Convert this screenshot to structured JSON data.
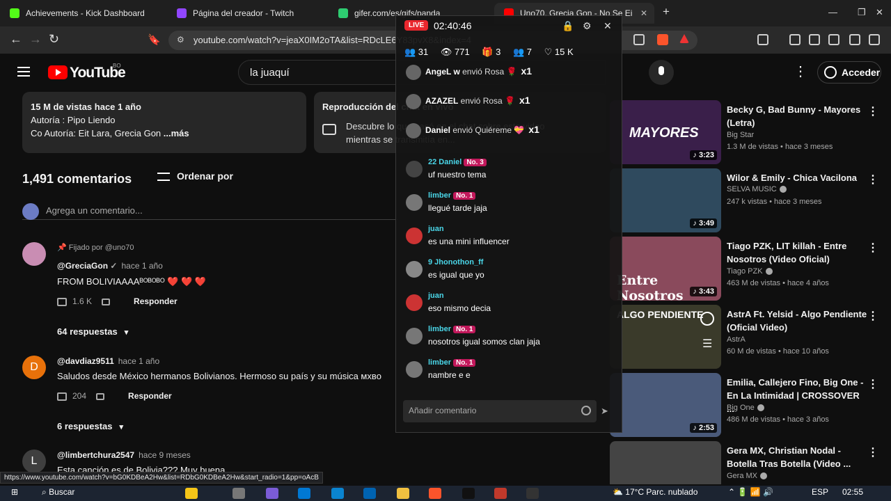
{
  "browser": {
    "tabs": [
      {
        "title": "Achievements - Kick Dashboard",
        "color": "#53fc18"
      },
      {
        "title": "Página del creador - Twitch",
        "color": "#9146ff"
      },
      {
        "title": "gifer.com/es/gifs/panda",
        "color": "#2ecc71"
      },
      {
        "title": "Uno70, Grecia Gon - No Se Ei",
        "color": "#ff0000"
      }
    ],
    "url": "youtube.com/watch?v=jeaX0IM2oTA&list=RDcLE6Y83pvX8&index=4",
    "new_tab": "+",
    "win_controls": [
      "—",
      "❐",
      "✕"
    ]
  },
  "youtube": {
    "logo": "YouTube",
    "country": "BO",
    "search_value": "la  juaquí",
    "signin_label": "Acceder"
  },
  "description": {
    "line1": "15 M de vistas  hace 1 año",
    "line2": "Autoría : Pipo Liendo",
    "line3": "Co Autoría: Eit Lara, Grecia Gon",
    "more": " ...más",
    "box2_title": "Reproducción del chat en vivo",
    "box2_text": "Descubre lo que pasó en el chat sobre este video mientras se transmitía en..."
  },
  "comments": {
    "count": "1,491 comentarios",
    "sort_label": "Ordenar por",
    "add_placeholder": "Agrega un comentario...",
    "items": [
      {
        "pinned": "Fijado por @uno70",
        "author": "@GreciaGon",
        "time": "hace 1 año",
        "text": "FROM BOLIVIAAAAᴮᴼᴮᴼᴮᴼ ❤️ ❤️ ❤️",
        "likes": "1.6 K",
        "reply": "Responder",
        "replies": "64 respuestas",
        "avatar": "",
        "avatar_color": "#c98db3"
      },
      {
        "pinned": "",
        "author": "@davdiaz9511",
        "time": "hace 1 año",
        "text": "Saludos desde México hermanos Bolivianos. Hermoso su país y su música ᴍxʙᴏ",
        "likes": "204",
        "reply": "Responder",
        "replies": "6 respuestas",
        "avatar": "D",
        "avatar_color": "#e8710a"
      },
      {
        "pinned": "",
        "author": "@limbertchura2547",
        "time": "hace 9 meses",
        "text": "Esta canción es de Bolivia??? Muy buena",
        "likes": "",
        "reply": "",
        "replies": "",
        "avatar": "L",
        "avatar_color": "#3f3f3f"
      }
    ]
  },
  "recommended": [
    {
      "title": "Becky G, Bad Bunny - Mayores (Letra)",
      "channel": "Big Star",
      "meta": "1.3 M de vistas • hace 3 meses",
      "duration": "3:23",
      "thumb_text": "MAYORES",
      "thumb_color": "#3a1f4a",
      "verified": false
    },
    {
      "title": "Wilor & Emily - Chica Vacilona",
      "channel": "SELVA MUSIC",
      "meta": "247 k vistas • hace 3 meses",
      "duration": "3:49",
      "thumb_text": "",
      "thumb_color": "#2f4a5e",
      "verified": true
    },
    {
      "title": "Tiago PZK, LIT killah - Entre Nosotros (Video Oficial)",
      "channel": "Tiago PZK",
      "meta": "463 M de vistas • hace 4 años",
      "duration": "3:43",
      "thumb_text": "Entre Nosotros",
      "thumb_color": "#8a4a5c",
      "verified": true
    },
    {
      "title": "AstrA Ft. Yelsid - Algo Pendiente (Oficial Video)",
      "channel": "AstrA",
      "meta": "60 M de vistas • hace 10 años",
      "duration": "",
      "thumb_text": "ALGO PENDIENTE",
      "thumb_color": "#3a3a2a",
      "verified": false
    },
    {
      "title": "Emilia, Callejero Fino, Big One - En La Intimidad | CROSSOVER ...",
      "channel": "Big One",
      "meta": "486 M de vistas • hace 3 años",
      "duration": "2:53",
      "thumb_text": "",
      "thumb_color": "#4a5a7a",
      "verified": true
    },
    {
      "title": "Gera MX, Christian Nodal - Botella Tras Botella (Video ...",
      "channel": "Gera MX",
      "meta": "",
      "duration": "",
      "thumb_text": "",
      "thumb_color": "#444444",
      "verified": true
    }
  ],
  "overlay": {
    "live": "LIVE",
    "timer": "02:40:46",
    "stats": [
      "👥 31",
      "👁 771",
      "🎁 3",
      "👥 7",
      "♡ 15 K"
    ],
    "gifts": [
      {
        "name": "AngeL w",
        "action": "envió Rosa 🌹",
        "mult": "x1"
      },
      {
        "name": "AZAZEL",
        "action": "envió Rosa 🌹",
        "mult": "x1"
      },
      {
        "name": "Daniel",
        "action": "envió Quiéreme 💝",
        "mult": "x1"
      }
    ],
    "messages": [
      {
        "head": "22 Daniel",
        "badge": "No. 3",
        "text": "uf nuestro tema",
        "avatar_color": "#444"
      },
      {
        "head": "limber",
        "badge": "No. 1",
        "text": "llegué tarde jaja",
        "avatar_color": "#777"
      },
      {
        "head": "juan",
        "badge": "",
        "text": "es una mini influencer",
        "avatar_color": "#c33"
      },
      {
        "head": "9 Jhonothon_ff",
        "badge": "",
        "text": "es igual que yo",
        "avatar_color": "#888"
      },
      {
        "head": "juan",
        "badge": "",
        "text": "eso mismo decia",
        "avatar_color": "#c33"
      },
      {
        "head": "limber",
        "badge": "No. 1",
        "text": "nosotros igual somos clan jaja",
        "avatar_color": "#777"
      },
      {
        "head": "limber",
        "badge": "No. 1",
        "text": "nambre e e",
        "avatar_color": "#777"
      }
    ],
    "input_placeholder": "Añadir comentario"
  },
  "status_link": "https://www.youtube.com/watch?v=bG0KDBeA2Hw&list=RDbG0KDBeA2Hw&start_radio=1&pp=oAcB",
  "taskbar": {
    "search": "Buscar",
    "weather": "17°C  Parc. nublado",
    "lang": "ESP",
    "time": "02:55"
  }
}
